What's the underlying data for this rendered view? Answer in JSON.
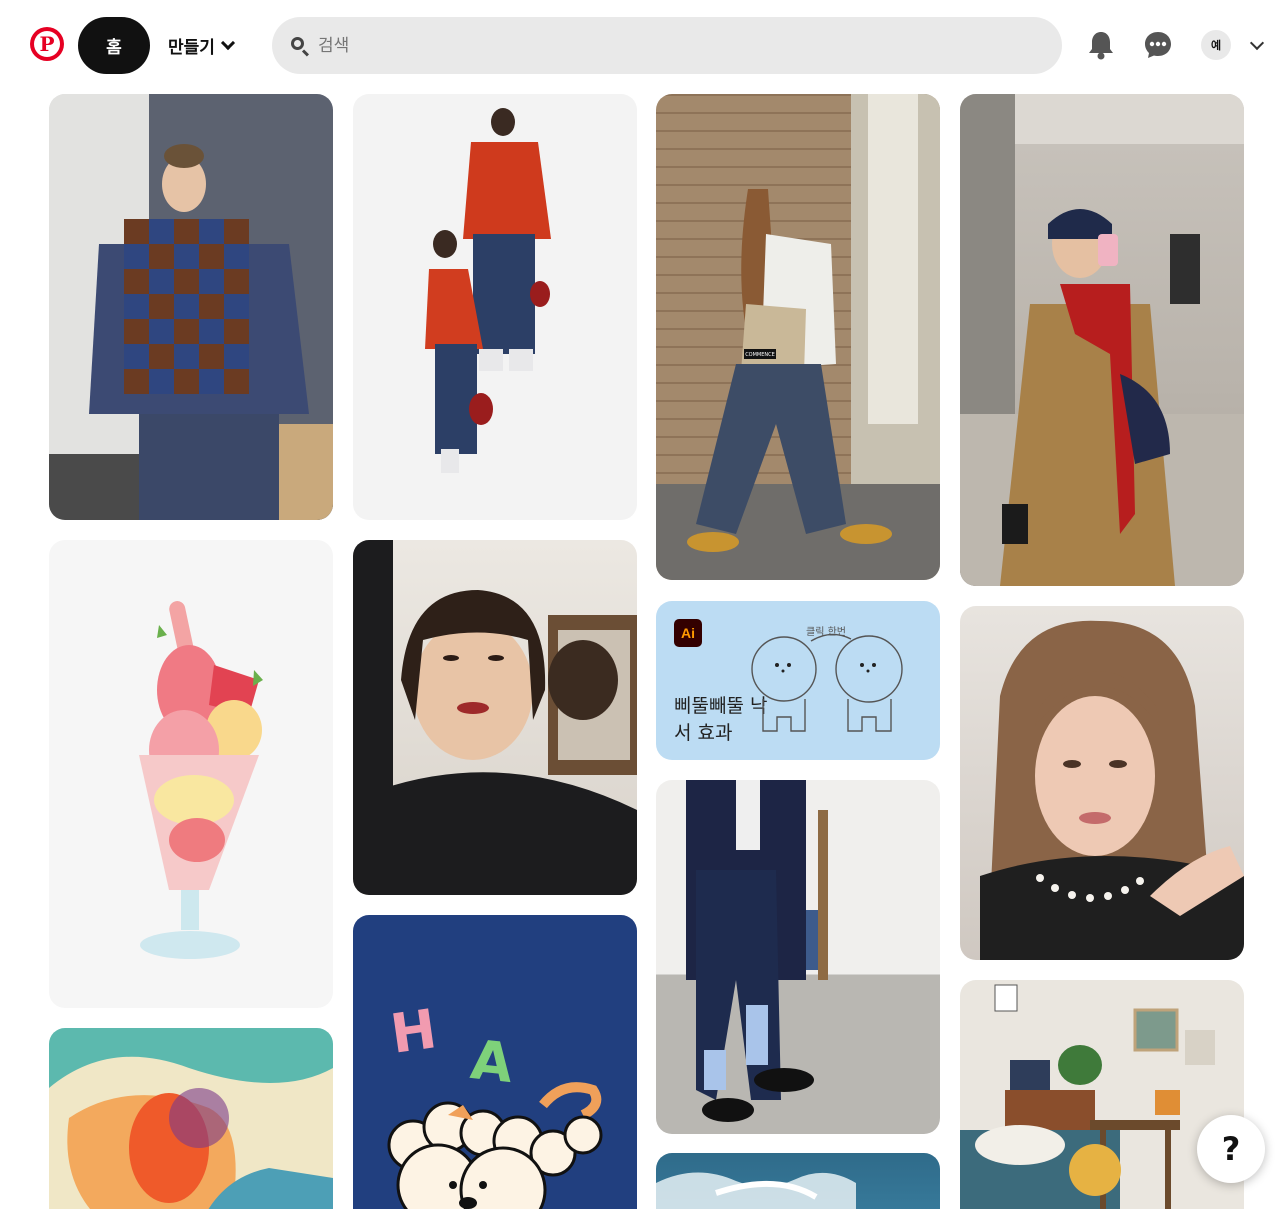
{
  "header": {
    "home_label": "홈",
    "create_label": "만들기",
    "search_placeholder": "검색",
    "avatar_initial": "예"
  },
  "pins": {
    "ai_card": {
      "badge": "Ai",
      "title": "삐뚤빼뚤 낙서 효과",
      "note": "클릭 한번"
    },
    "commence_bag_text": "COMMENCE",
    "happy_letters": [
      "H",
      "A"
    ]
  },
  "help_button": "?",
  "colors": {
    "brand": "#e60023",
    "home_active_bg": "#111111",
    "search_bg": "#e9e9e9"
  }
}
